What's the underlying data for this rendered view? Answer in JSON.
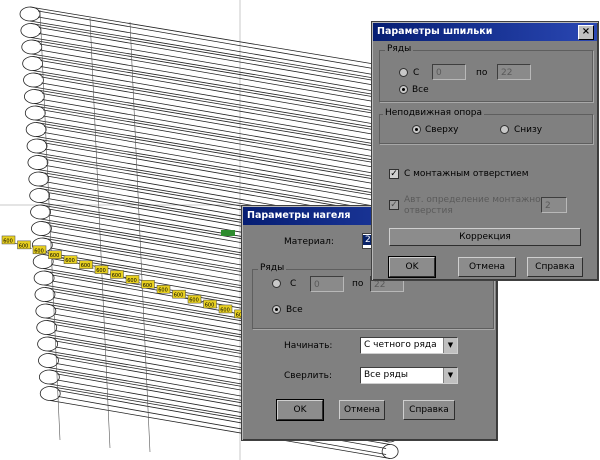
{
  "background": {
    "dim_labels": [
      "600",
      "600",
      "600",
      "600",
      "600",
      "600",
      "600",
      "600",
      "600",
      "600",
      "600",
      "600",
      "600",
      "600",
      "600",
      "600"
    ]
  },
  "dowel_dialog": {
    "title": "Параметры нагеля",
    "material_label": "Материал:",
    "material_value": "2",
    "rows_group_label": "Ряды",
    "from_label": "С",
    "from_value": "0",
    "to_label": "по",
    "to_value": "22",
    "all_label": "Все",
    "start_label": "Начинать:",
    "start_value": "С четного ряда",
    "drill_label": "Сверлить:",
    "drill_value": "Все ряды",
    "ok_label": "OK",
    "cancel_label": "Отмена",
    "help_label": "Справка"
  },
  "stud_dialog": {
    "title": "Параметры шпильки",
    "close_glyph": "×",
    "rows_group_label": "Ряды",
    "from_label": "С",
    "from_value": "0",
    "to_label": "по",
    "to_value": "22",
    "all_label": "Все",
    "fixed_support_group_label": "Неподвижная опора",
    "top_label": "Сверху",
    "bottom_label": "Снизу",
    "mount_hole_label": "С монтажным отверстием",
    "auto_mount_label_1": "Авт. определение монтажного",
    "auto_mount_label_2": "отверстия",
    "auto_mount_value": "2",
    "correction_label": "Коррекция",
    "ok_label": "OK",
    "cancel_label": "Отмена",
    "help_label": "Справка"
  },
  "colors": {
    "title_bar": "#0a246a",
    "dialog_face": "#808080",
    "dim_label": "#e8d020",
    "green_marker": "#2e8b2e"
  }
}
